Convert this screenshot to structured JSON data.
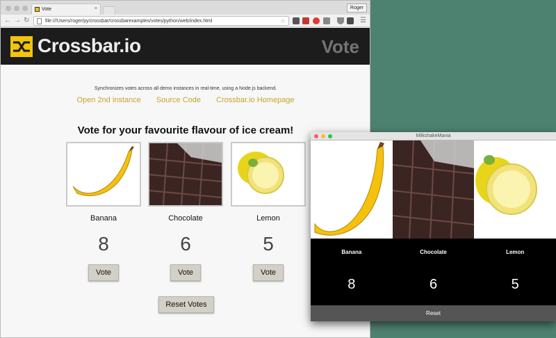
{
  "browser": {
    "tab_title": "Vote",
    "tab_close": "×",
    "user_button": "Roger",
    "url": "file:///Users/roger/py/crossbar/crossbarexamples/votes/python/web/index.html"
  },
  "header": {
    "logo_text": "Crossbar.io",
    "title": "Vote"
  },
  "page": {
    "description": "Synchronizes votes across all demo instances in real-time, using a Node.js backend.",
    "links": [
      "Open 2nd instance",
      "Source Code",
      "Crossbar.io Homepage"
    ],
    "question": "Vote for your favourite flavour of ice cream!",
    "flavours": [
      {
        "name": "Banana",
        "votes": "8",
        "vote_label": "Vote"
      },
      {
        "name": "Chocolate",
        "votes": "6",
        "vote_label": "Vote"
      },
      {
        "name": "Lemon",
        "votes": "5",
        "vote_label": "Vote"
      }
    ],
    "reset_label": "Reset Votes"
  },
  "app": {
    "window_title": "MilkshakeMania",
    "flavours": [
      {
        "name": "Banana",
        "votes": "8"
      },
      {
        "name": "Chocolate",
        "votes": "6"
      },
      {
        "name": "Lemon",
        "votes": "5"
      }
    ],
    "reset_label": "Reset"
  },
  "colors": {
    "brand_yellow": "#f2c40c",
    "link": "#c8a32c",
    "header_bg": "#1c1c1c"
  },
  "icons": [
    "back-arrow-icon",
    "forward-arrow-icon",
    "reload-icon",
    "star-icon",
    "menu-icon"
  ]
}
